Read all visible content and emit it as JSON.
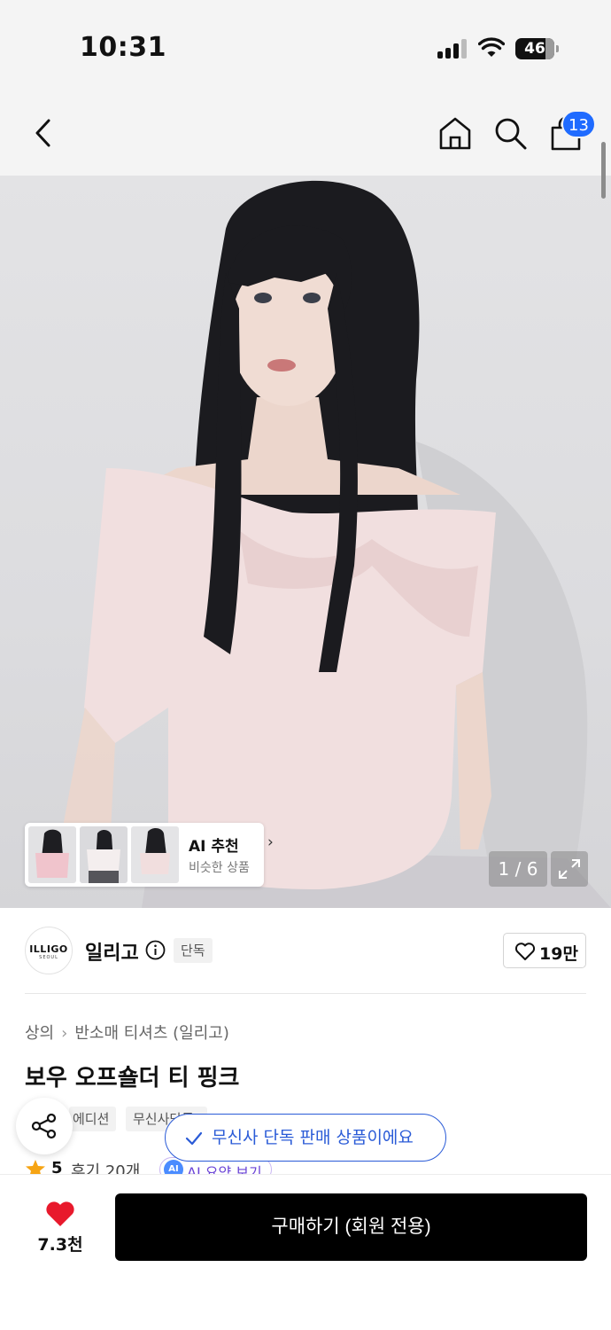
{
  "status_bar": {
    "time": "10:31",
    "battery": "46"
  },
  "nav": {
    "cart_count": "13"
  },
  "gallery": {
    "page_counter": "1 / 6",
    "ai_recommend": {
      "title": "AI 추천",
      "subtitle": "비슷한 상품"
    }
  },
  "brand": {
    "logo_text": "ILLIGO",
    "logo_subtext": "SEOUL",
    "name": "일리고",
    "badge": "단독",
    "likes": "19만"
  },
  "breadcrumb": [
    "상의",
    "반소매 티셔츠 (일리고)"
  ],
  "product": {
    "title": "보우 오프숄더 티 핑크",
    "tags": [
      "에디션",
      "무신사단독"
    ],
    "rating": "5",
    "reviews": "후기 20개",
    "ai_summary": "AI 요약 보기"
  },
  "toast": {
    "message": "무신사 단독 판매 상품이에요"
  },
  "bottom": {
    "wishlist_count": "7.3천",
    "buy_label": "구매하기 (회원 전용)"
  },
  "colors": {
    "accent_blue": "#2a5bd7",
    "badge_blue": "#1f6bff",
    "heart_red": "#e8192c",
    "buy_button": "#000000"
  },
  "icons": [
    "back-arrow-icon",
    "home-icon",
    "search-icon",
    "shopping-bag-icon",
    "info-icon",
    "heart-outline-icon",
    "star-icon",
    "share-icon",
    "check-icon",
    "heart-filled-icon",
    "expand-icon"
  ]
}
